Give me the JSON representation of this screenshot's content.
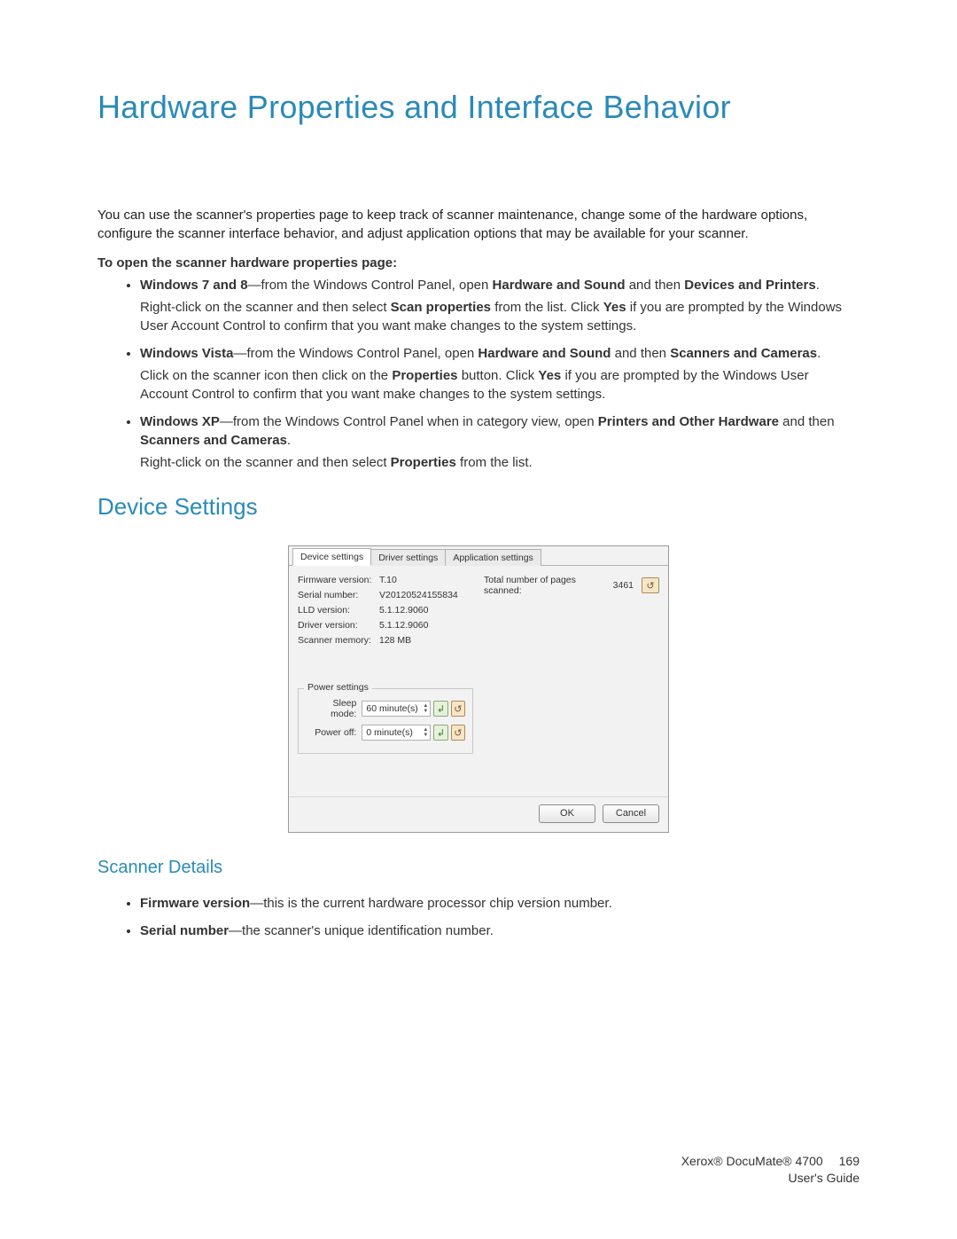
{
  "title": "Hardware Properties and Interface Behavior",
  "intro": "You can use the scanner's properties page to keep track of scanner maintenance, change some of the hardware options, configure the scanner interface behavior, and adjust application options that may be available for your scanner.",
  "open_heading": "To open the scanner hardware properties page:",
  "bullets": {
    "win78": {
      "os": "Windows 7 and 8",
      "lead": "—from the Windows Control Panel, open ",
      "hw_sound": "Hardware and Sound",
      "and_then": " and then ",
      "devices": "Devices and Printers",
      "sub_pre": "Right-click on the scanner and then select ",
      "scanprops": "Scan properties",
      "sub_mid": " from the list. Click ",
      "yes": "Yes",
      "sub_post": " if you are prompted by the Windows User Account Control to confirm that you want make changes to the system settings."
    },
    "vista": {
      "os": "Windows Vista",
      "lead": "—from the Windows Control Panel, open ",
      "hw_sound": "Hardware and Sound",
      "and_then": " and then ",
      "scanners": "Scanners and Cameras",
      "sub_pre": "Click on the scanner icon then click on the ",
      "properties": "Properties",
      "sub_mid": " button. Click ",
      "yes": "Yes",
      "sub_post": " if you are prompted by the Windows User Account Control to confirm that you want make changes to the system settings."
    },
    "xp": {
      "os": "Windows XP",
      "lead": "—from the Windows Control Panel when in category view, open ",
      "printers": "Printers and Other Hardware",
      "and_then": " and then ",
      "scanners": "Scanners and Cameras",
      "sub_pre": "Right-click on the scanner and then select ",
      "properties": "Properties",
      "sub_post": " from the list."
    }
  },
  "section_device": "Device Settings",
  "dialog": {
    "tabs": [
      "Device settings",
      "Driver settings",
      "Application settings"
    ],
    "info": {
      "firmware_lbl": "Firmware version:",
      "firmware_val": "T.10",
      "serial_lbl": "Serial number:",
      "serial_val": "V20120524155834",
      "lld_lbl": "LLD version:",
      "lld_val": "5.1.12.9060",
      "driver_lbl": "Driver version:",
      "driver_val": "5.1.12.9060",
      "mem_lbl": "Scanner memory:",
      "mem_val": "128 MB"
    },
    "stats": {
      "total_lbl": "Total number of pages scanned:",
      "total_val": "3461"
    },
    "power": {
      "legend": "Power settings",
      "sleep_lbl": "Sleep mode:",
      "sleep_val": "60 minute(s)",
      "off_lbl": "Power off:",
      "off_val": "0 minute(s)"
    },
    "ok": "OK",
    "cancel": "Cancel"
  },
  "section_scanner_details": "Scanner Details",
  "details": {
    "fw_b": "Firmware version",
    "fw_rest": "—this is the current hardware processor chip version number.",
    "sn_b": "Serial number",
    "sn_rest": "—the scanner's unique identification number."
  },
  "footer": {
    "product": "Xerox® DocuMate® 4700",
    "guide": "User's Guide",
    "page": "169"
  }
}
